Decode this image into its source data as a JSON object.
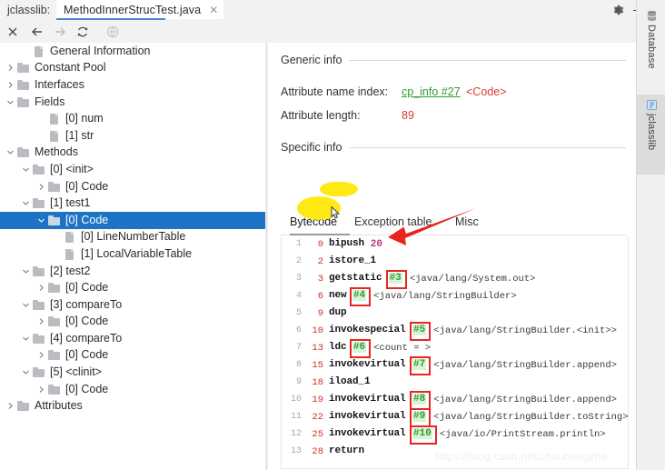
{
  "window": {
    "plugin_label": "jclasslib:",
    "gear_icon": "gear-icon",
    "minimize_icon": "minimize-icon"
  },
  "tab": {
    "title": "MethodInnerStrucTest.java",
    "close_icon": "close-icon"
  },
  "toolbar": {
    "buttons": [
      {
        "name": "close-icon",
        "glyph": "✕",
        "enabled": true
      },
      {
        "name": "back-arrow-icon",
        "glyph": "←",
        "enabled": true
      },
      {
        "name": "forward-arrow-icon",
        "glyph": "→",
        "enabled": false
      },
      {
        "name": "reload-icon",
        "glyph": "↻",
        "enabled": true
      },
      {
        "name": "browse-globe-icon",
        "glyph": "◌",
        "enabled": false
      }
    ]
  },
  "tree": {
    "items": [
      {
        "label": "General Information",
        "depth": 1,
        "twisty": "none",
        "icon": "leaf",
        "selected": false
      },
      {
        "label": "Constant Pool",
        "depth": 0,
        "twisty": "closed",
        "icon": "folder",
        "selected": false
      },
      {
        "label": "Interfaces",
        "depth": 0,
        "twisty": "closed",
        "icon": "folder",
        "selected": false
      },
      {
        "label": "Fields",
        "depth": 0,
        "twisty": "open",
        "icon": "folder",
        "selected": false
      },
      {
        "label": "[0] num",
        "depth": 2,
        "twisty": "none",
        "icon": "leaf",
        "selected": false
      },
      {
        "label": "[1] str",
        "depth": 2,
        "twisty": "none",
        "icon": "leaf",
        "selected": false
      },
      {
        "label": "Methods",
        "depth": 0,
        "twisty": "open",
        "icon": "folder",
        "selected": false
      },
      {
        "label": "[0] <init>",
        "depth": 1,
        "twisty": "open",
        "icon": "folder",
        "selected": false
      },
      {
        "label": "[0] Code",
        "depth": 2,
        "twisty": "closed",
        "icon": "folder",
        "selected": false
      },
      {
        "label": "[1] test1",
        "depth": 1,
        "twisty": "open",
        "icon": "folder",
        "selected": false
      },
      {
        "label": "[0] Code",
        "depth": 2,
        "twisty": "open",
        "icon": "folder",
        "selected": true
      },
      {
        "label": "[0] LineNumberTable",
        "depth": 3,
        "twisty": "none",
        "icon": "leaf",
        "selected": false
      },
      {
        "label": "[1] LocalVariableTable",
        "depth": 3,
        "twisty": "none",
        "icon": "leaf",
        "selected": false
      },
      {
        "label": "[2] test2",
        "depth": 1,
        "twisty": "open",
        "icon": "folder",
        "selected": false
      },
      {
        "label": "[0] Code",
        "depth": 2,
        "twisty": "closed",
        "icon": "folder",
        "selected": false
      },
      {
        "label": "[3] compareTo",
        "depth": 1,
        "twisty": "open",
        "icon": "folder",
        "selected": false
      },
      {
        "label": "[0] Code",
        "depth": 2,
        "twisty": "closed",
        "icon": "folder",
        "selected": false
      },
      {
        "label": "[4] compareTo",
        "depth": 1,
        "twisty": "open",
        "icon": "folder",
        "selected": false
      },
      {
        "label": "[0] Code",
        "depth": 2,
        "twisty": "closed",
        "icon": "folder",
        "selected": false
      },
      {
        "label": "[5] <clinit>",
        "depth": 1,
        "twisty": "open",
        "icon": "folder",
        "selected": false
      },
      {
        "label": "[0] Code",
        "depth": 2,
        "twisty": "closed",
        "icon": "folder",
        "selected": false
      },
      {
        "label": "Attributes",
        "depth": 0,
        "twisty": "closed",
        "icon": "folder",
        "selected": false
      }
    ]
  },
  "detail": {
    "generic_info_title": "Generic info",
    "attribute_name_index_label": "Attribute name index:",
    "attribute_name_index_link": "cp_info #27",
    "attribute_name_index_value": "<Code>",
    "attribute_length_label": "Attribute length:",
    "attribute_length_value": "89",
    "specific_info_title": "Specific info",
    "tabs": [
      {
        "label": "Bytecode",
        "active": true
      },
      {
        "label": "Exception table",
        "active": false
      },
      {
        "label": "Misc",
        "active": false
      }
    ]
  },
  "bytecode": {
    "lines": [
      {
        "n": "1",
        "offset": "0",
        "op": "bipush",
        "arg": "",
        "imm": "20",
        "desc": ""
      },
      {
        "n": "2",
        "offset": "2",
        "op": "istore_1",
        "arg": "",
        "imm": "",
        "desc": ""
      },
      {
        "n": "3",
        "offset": "3",
        "op": "getstatic",
        "arg": "#3",
        "imm": "",
        "desc": "<java/lang/System.out>"
      },
      {
        "n": "4",
        "offset": "6",
        "op": "new",
        "arg": "#4",
        "imm": "",
        "desc": "<java/lang/StringBuilder>"
      },
      {
        "n": "5",
        "offset": "9",
        "op": "dup",
        "arg": "",
        "imm": "",
        "desc": ""
      },
      {
        "n": "6",
        "offset": "10",
        "op": "invokespecial",
        "arg": "#5",
        "imm": "",
        "desc": "<java/lang/StringBuilder.<init>>"
      },
      {
        "n": "7",
        "offset": "13",
        "op": "ldc",
        "arg": "#6",
        "imm": "",
        "desc": "<count = >"
      },
      {
        "n": "8",
        "offset": "15",
        "op": "invokevirtual",
        "arg": "#7",
        "imm": "",
        "desc": "<java/lang/StringBuilder.append>"
      },
      {
        "n": "9",
        "offset": "18",
        "op": "iload_1",
        "arg": "",
        "imm": "",
        "desc": ""
      },
      {
        "n": "10",
        "offset": "19",
        "op": "invokevirtual",
        "arg": "#8",
        "imm": "",
        "desc": "<java/lang/StringBuilder.append>"
      },
      {
        "n": "11",
        "offset": "22",
        "op": "invokevirtual",
        "arg": "#9",
        "imm": "",
        "desc": "<java/lang/StringBuilder.toString>"
      },
      {
        "n": "12",
        "offset": "25",
        "op": "invokevirtual",
        "arg": "#10",
        "imm": "",
        "desc": "<java/io/PrintStream.println>"
      },
      {
        "n": "13",
        "offset": "28",
        "op": "return",
        "arg": "",
        "imm": "",
        "desc": ""
      }
    ]
  },
  "right_tool_tabs": [
    {
      "label": "Database",
      "icon": "database-icon",
      "active": false
    },
    {
      "label": "jclasslib",
      "icon": "jclasslib-icon",
      "active": true
    }
  ],
  "watermark": "https://blog.csdn.net/zhouhengzhe",
  "colors": {
    "selection_blue": "#1d74c4",
    "tab_underline": "#4a86d0",
    "link_green": "#2ea02e",
    "value_red": "#d23f31",
    "annotation_red": "#e8251f",
    "highlight_yellow": "#ffe600",
    "offset_red": "#cc3322",
    "immediate_magenta": "#c4318a"
  }
}
